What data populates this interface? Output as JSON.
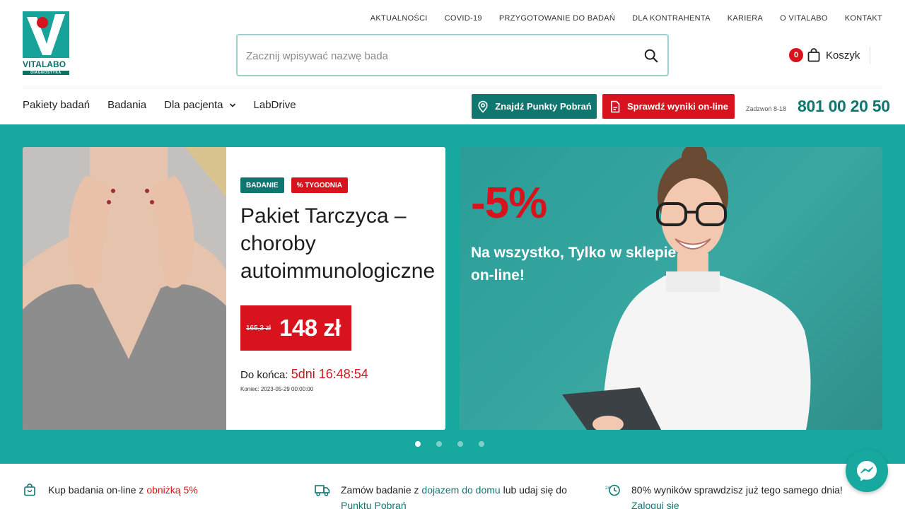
{
  "brand": {
    "name": "VITALABO",
    "tagline": "DIAGNOSTYKA"
  },
  "topnav": [
    {
      "label": "AKTUALNOŚCI"
    },
    {
      "label": "COVID-19"
    },
    {
      "label": "PRZYGOTOWANIE DO BADAŃ"
    },
    {
      "label": "DLA KONTRAHENTA"
    },
    {
      "label": "KARIERA"
    },
    {
      "label": "O VITALABO"
    },
    {
      "label": "KONTAKT"
    }
  ],
  "search": {
    "placeholder": "Zacznij wpisywać nazwę bada",
    "value": ""
  },
  "cart": {
    "count": "0",
    "label": "Koszyk"
  },
  "mainnav": {
    "items": [
      {
        "label": "Pakiety badań"
      },
      {
        "label": "Badania"
      },
      {
        "label": "Dla pacjenta"
      },
      {
        "label": "LabDrive"
      }
    ]
  },
  "buttons": {
    "find_points": "Znajdź Punkty Pobrań",
    "check_results": "Sprawdź wyniki on-line"
  },
  "contact": {
    "call_label": "Zadzwoń 8-18",
    "phone": "801 00 20 50"
  },
  "hero": {
    "card1": {
      "badge1": "BADANIE",
      "badge2": "% TYGODNIA",
      "title_line1": "Pakiet Tarczyca –",
      "title_line2": "choroby",
      "title_line3": "autoimmunologiczne",
      "old_price": "165,3 zł",
      "new_price": "148 zł",
      "countdown_label": "Do końca: ",
      "countdown_value": "5dni 16:48:54",
      "end_label": "Koniec: 2023-05-29 00:00:00"
    },
    "card2": {
      "discount": "-5%",
      "line1": "Na wszystko, Tylko w sklepie",
      "line2": "on-line!"
    },
    "slides_total": 4,
    "active_slide": 1
  },
  "features": [
    {
      "text_before": "Kup badania on-line z ",
      "highlight": "obniżką 5%",
      "text_after": ""
    },
    {
      "text_before": "Zamów badanie z ",
      "highlight": "dojazem do domu",
      "text_after": " lub udaj się do",
      "line2": "Punktu Pobrań"
    },
    {
      "text_before": "80% wyników sprawdzisz już tego samego dnia! ",
      "line2": "Zaloguj się",
      "icon_label": "24"
    }
  ],
  "colors": {
    "teal": "#17a9a0",
    "teal_dark": "#0f7770",
    "red": "#d8131d"
  },
  "icons": [
    "search-icon",
    "cart-icon",
    "chevron-down-icon",
    "location-pin-icon",
    "document-icon",
    "bag-icon",
    "truck-icon",
    "clock-24-icon",
    "messenger-icon"
  ]
}
